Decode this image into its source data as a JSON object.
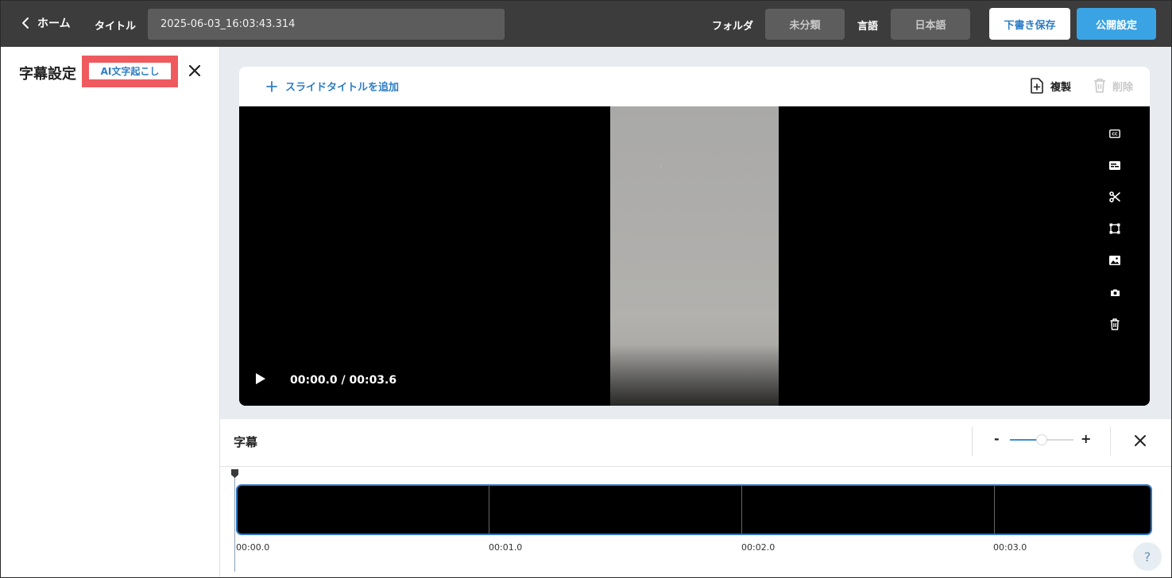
{
  "header": {
    "home_label": "ホーム",
    "title_label": "タイトル",
    "title_value": "2025-06-03_16:03:43.314",
    "folder_label": "フォルダ",
    "folder_value": "未分類",
    "language_label": "言語",
    "language_value": "日本語",
    "draft_label": "下書き保存",
    "publish_label": "公開設定"
  },
  "left_panel": {
    "title": "字幕設定",
    "ai_label": "AI文字起こし"
  },
  "slide": {
    "add_title_label": "スライドタイトルを追加",
    "duplicate_label": "複製",
    "delete_label": "削除",
    "time_display": "00:00.0 / 00:03.6",
    "side_tools": [
      "cc-icon",
      "subtitles-icon",
      "scissors-icon",
      "crop-icon",
      "image-icon",
      "camera-icon",
      "trash-icon"
    ]
  },
  "subtitle_panel": {
    "title": "字幕",
    "zoom_minus": "-",
    "zoom_plus": "+",
    "zoom_level": 0.5,
    "ticks": [
      "00:00.0",
      "00:01.0",
      "00:02.0",
      "00:03.0"
    ],
    "help_label": "?"
  },
  "colors": {
    "header_bg": "#3c3c3c",
    "accent_blue": "#2e7ec6",
    "publish_blue": "#3aa3e3",
    "highlight_red": "#ef5a5e",
    "track_border": "#2f75c0"
  }
}
